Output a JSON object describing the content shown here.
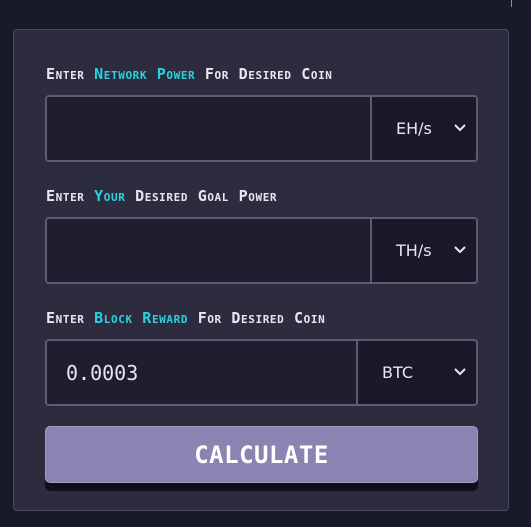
{
  "form": {
    "network": {
      "label_prefix": "Enter ",
      "label_highlight": "Network Power",
      "label_suffix": " For Desired Coin",
      "value": "",
      "unit": "EH/s"
    },
    "goal": {
      "label_prefix": "Enter ",
      "label_highlight": "Your",
      "label_suffix": " Desired Goal Power",
      "value": "",
      "unit": "TH/s"
    },
    "reward": {
      "label_prefix": "Enter ",
      "label_highlight": "Block Reward",
      "label_suffix": " For Desired Coin",
      "value": "0.0003",
      "unit": "BTC"
    },
    "calculate_label": "CALCULATE"
  },
  "colors": {
    "highlight": "#2ad1df",
    "button": "#8b84b3",
    "panel": "#2d2c3e",
    "background": "#181a29"
  }
}
